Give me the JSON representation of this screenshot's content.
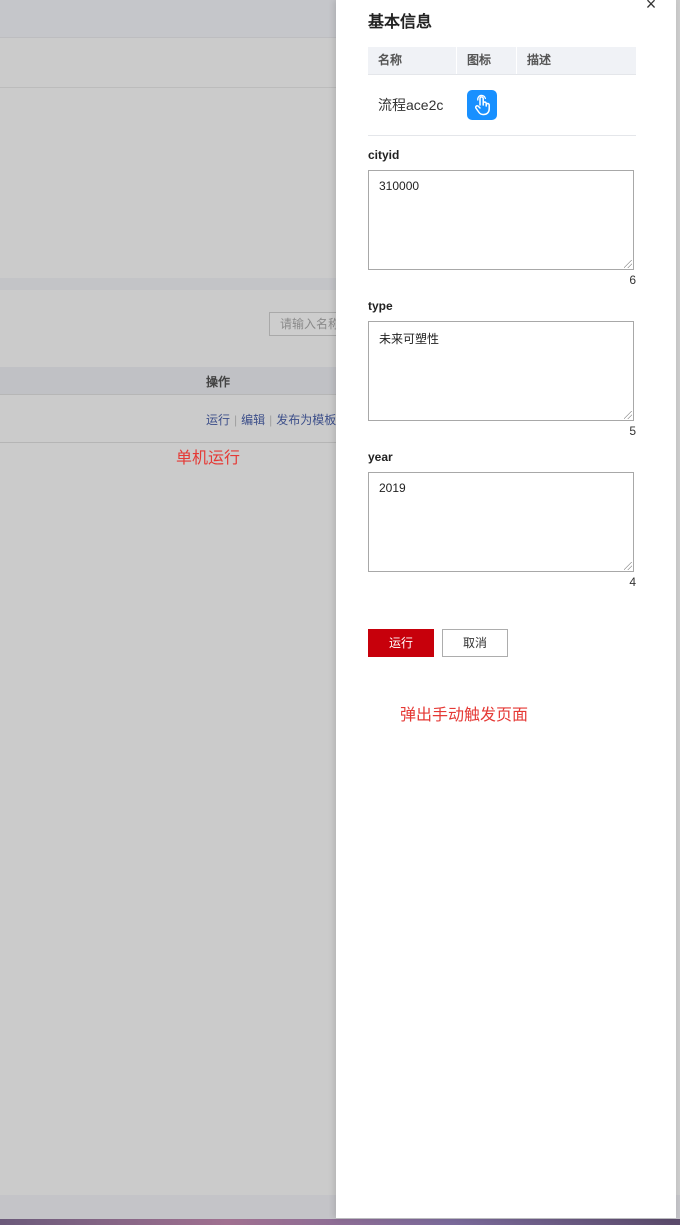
{
  "background": {
    "search_placeholder": "请输入名称",
    "table_header_action": "操作",
    "row_actions": {
      "run": "运行",
      "edit": "编辑",
      "publish_template": "发布为模板"
    },
    "annotation": "单机运行"
  },
  "drawer": {
    "close_icon": "×",
    "section_title": "基本信息",
    "info_table": {
      "headers": [
        "名称",
        "图标",
        "描述"
      ],
      "row": {
        "name": "流程ace2c",
        "icon": "pointer-hand-icon",
        "description": ""
      }
    },
    "fields": [
      {
        "label": "cityid",
        "value": "310000",
        "count": "6"
      },
      {
        "label": "type",
        "value": "未来可塑性",
        "count": "5"
      },
      {
        "label": "year",
        "value": "2019",
        "count": "4"
      }
    ],
    "buttons": {
      "run": "运行",
      "cancel": "取消"
    },
    "annotation": "弹出手动触发页面"
  },
  "colors": {
    "primary_button": "#c7000b",
    "icon_bg": "#1890ff",
    "annotation_red": "#e53935",
    "link": "#3d4f8a"
  }
}
